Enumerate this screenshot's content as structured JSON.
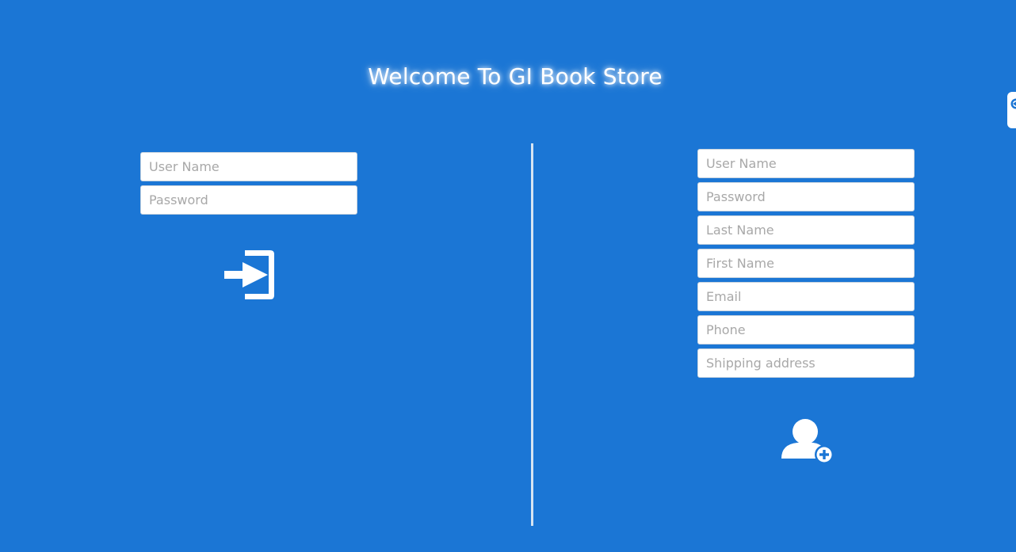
{
  "header": {
    "title": "Welcome To GI Book Store"
  },
  "login": {
    "username_placeholder": "User Name",
    "password_placeholder": "Password",
    "submit_icon": "sign-in-icon"
  },
  "signup": {
    "username_placeholder": "User Name",
    "password_placeholder": "Password",
    "last_name_placeholder": "Last Name",
    "first_name_placeholder": "First Name",
    "email_placeholder": "Email",
    "phone_placeholder": "Phone",
    "shipping_placeholder": "Shipping address",
    "submit_icon": "add-user-icon"
  },
  "side_tab": {
    "icon": "extension-tab-icon"
  },
  "colors": {
    "background": "#1b76d5",
    "field_background": "#ffffff",
    "placeholder": "#a8a8a8",
    "divider": "#d6e4f2"
  }
}
